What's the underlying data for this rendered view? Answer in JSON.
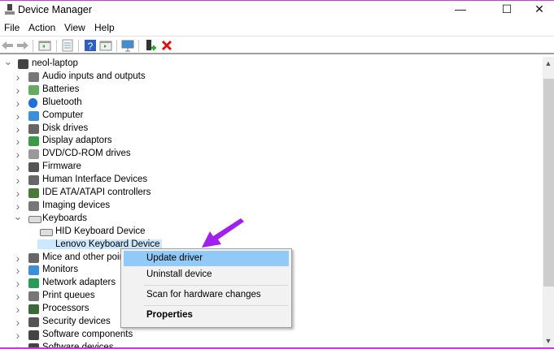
{
  "window": {
    "title": "Device Manager",
    "minimize": "—",
    "maximize": "☐",
    "close": "✕"
  },
  "menu": [
    "File",
    "Action",
    "View",
    "Help"
  ],
  "toolbar": [
    "back-icon",
    "forward-icon",
    "show-hide-console-tree-icon",
    "properties-icon",
    "help-icon",
    "action-pane-icon",
    "scan-hardware-icon",
    "update-driver-icon",
    "uninstall-icon"
  ],
  "tree": {
    "root": "neol-laptop",
    "items": [
      {
        "label": "Audio inputs and outputs",
        "icon": "speaker-icon"
      },
      {
        "label": "Batteries",
        "icon": "battery-icon"
      },
      {
        "label": "Bluetooth",
        "icon": "bluetooth-icon"
      },
      {
        "label": "Computer",
        "icon": "computer-icon"
      },
      {
        "label": "Disk drives",
        "icon": "disk-icon"
      },
      {
        "label": "Display adaptors",
        "icon": "display-icon"
      },
      {
        "label": "DVD/CD-ROM drives",
        "icon": "dvd-icon"
      },
      {
        "label": "Firmware",
        "icon": "firmware-icon"
      },
      {
        "label": "Human Interface Devices",
        "icon": "hid-icon"
      },
      {
        "label": "IDE ATA/ATAPI controllers",
        "icon": "ide-icon"
      },
      {
        "label": "Imaging devices",
        "icon": "camera-icon"
      },
      {
        "label": "Keyboards",
        "icon": "keyboard-icon",
        "expanded": true,
        "children": [
          "HID Keyboard Device",
          "Lenovo Keyboard Device"
        ]
      },
      {
        "label": "Mice and other pointing devices",
        "icon": "mouse-icon"
      },
      {
        "label": "Monitors",
        "icon": "monitor-icon"
      },
      {
        "label": "Network adapters",
        "icon": "network-icon"
      },
      {
        "label": "Print queues",
        "icon": "printer-icon"
      },
      {
        "label": "Processors",
        "icon": "processor-icon"
      },
      {
        "label": "Security devices",
        "icon": "security-icon"
      },
      {
        "label": "Software components",
        "icon": "software-icon"
      },
      {
        "label": "Software devices",
        "icon": "software-icon"
      }
    ]
  },
  "context_menu": {
    "items": [
      "Update driver",
      "Uninstall device",
      "Scan for hardware changes",
      "Properties"
    ],
    "highlighted": "Update driver"
  },
  "colors": {
    "selection": "#cce8ff",
    "menu_highlight": "#91c9f7",
    "arrow": "#a020f0",
    "border": "#c63bd6"
  }
}
